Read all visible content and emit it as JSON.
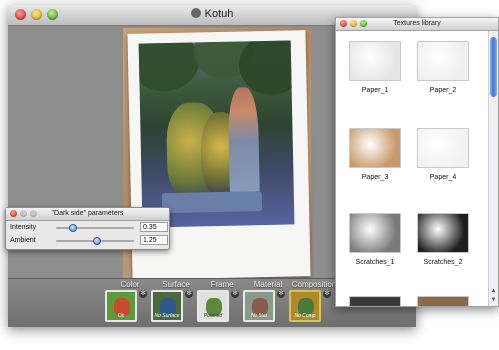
{
  "app": {
    "title": "Kotuh"
  },
  "effects": [
    {
      "label": "Color",
      "caption": "Ok"
    },
    {
      "label": "Surface",
      "caption": "No Surface"
    },
    {
      "label": "Frame",
      "caption": "Polaroid"
    },
    {
      "label": "Material",
      "caption": "No Mat"
    },
    {
      "label": "Composition",
      "caption": "No Comp"
    }
  ],
  "params": {
    "title": "\"Dark side\" parameters",
    "rows": [
      {
        "label": "Intensity",
        "value": "0.35",
        "level": 0.22
      },
      {
        "label": "Ambient",
        "value": "1.25",
        "level": 0.52
      }
    ]
  },
  "library": {
    "title": "Textures library",
    "items": [
      {
        "label": "Paper_1",
        "swatch": "#e6e6e6"
      },
      {
        "label": "Paper_2",
        "swatch": "#efefef"
      },
      {
        "label": "Paper_3",
        "swatch": "#c8996a"
      },
      {
        "label": "Paper_4",
        "swatch": "#f2f2f2"
      },
      {
        "label": "Scratches_1",
        "swatch": "#7a7a7a"
      },
      {
        "label": "Scratches_2",
        "swatch": "#1e1e1e"
      }
    ]
  },
  "colors": {
    "accent": "#3b77d1",
    "bar": "#7d7d7d"
  }
}
